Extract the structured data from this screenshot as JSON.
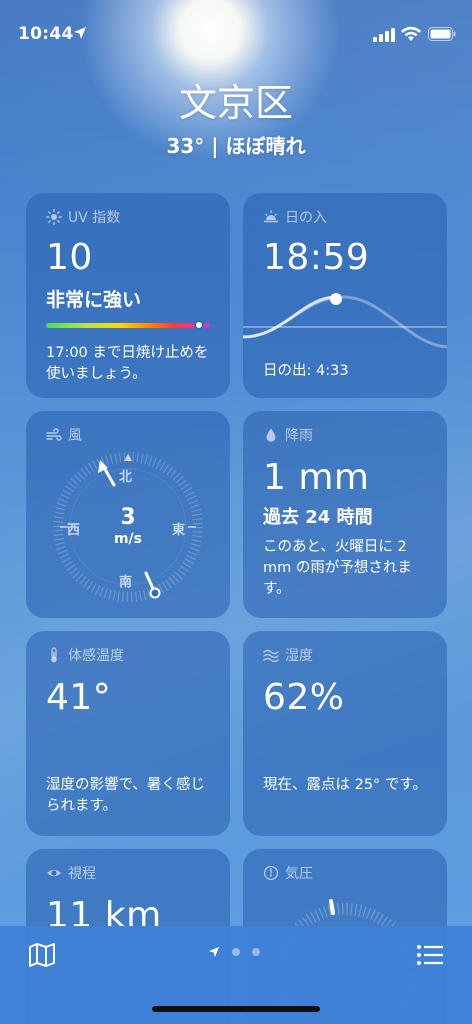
{
  "status": {
    "time": "10:44"
  },
  "header": {
    "city": "文京区",
    "summary": "33° | ほぼ晴れ"
  },
  "uv": {
    "title": "UV 指数",
    "value": "10",
    "level": "非常に強い",
    "level_fraction": 0.93,
    "advice": "17:00 まで日焼け止めを使いましょう。"
  },
  "sunset": {
    "title": "日の入",
    "time": "18:59",
    "sunrise": "日の出: 4:33"
  },
  "wind": {
    "title": "風",
    "speed": "3",
    "unit": "m/s",
    "dirs": {
      "n": "北",
      "e": "東",
      "s": "南",
      "w": "西"
    }
  },
  "rain": {
    "title": "降雨",
    "amount": "1 mm",
    "period": "過去 24 時間",
    "forecast": "このあと、火曜日に 2 mm の雨が予想されます。"
  },
  "feels": {
    "title": "体感温度",
    "value": "41°",
    "note": "湿度の影響で、暑く感じられます。"
  },
  "humidity": {
    "title": "湿度",
    "value": "62%",
    "note": "現在、露点は 25° です。"
  },
  "visibility": {
    "title": "視程",
    "value": "11 km"
  },
  "pressure": {
    "title": "気圧"
  },
  "colors": {
    "card": "#2f6cc0",
    "tabbar": "#3e82d7"
  }
}
